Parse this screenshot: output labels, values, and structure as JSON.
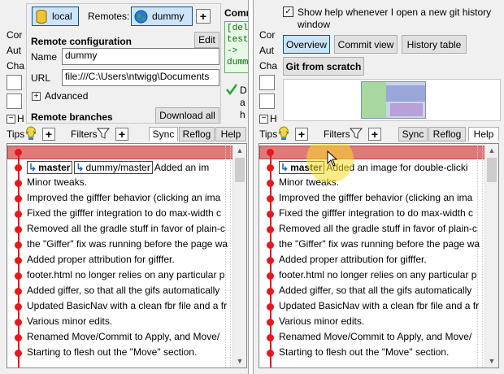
{
  "left": {
    "side_labels": [
      "Cor",
      "Aut",
      "Cha"
    ],
    "remote_location_button": "local",
    "remotes_label": "Remotes:",
    "remote_button": "dummy",
    "commit_header_partial": "Comr",
    "commit_preview_lines": [
      "[del",
      "test",
      "->",
      "dumm"
    ],
    "done_partial_lines": [
      "D",
      "a",
      "h"
    ],
    "remote_config_title": "Remote configuration",
    "edit_button": "Edit",
    "name_label": "Name",
    "name_value": "dummy",
    "url_label": "URL",
    "url_value": "file:///C:\\Users\\ntwigg\\Documents",
    "advanced_label": "Advanced",
    "remote_branches_title": "Remote branches",
    "download_all_button": "Download all",
    "collapse_header_partial": "H",
    "toolbar": {
      "tips": "Tips",
      "filters": "Filters",
      "sync": "Sync",
      "reflog": "Reflog",
      "help": "Help"
    },
    "branch_master": "master",
    "branch_remote": "dummy/master",
    "first_commit_text": "Added an im"
  },
  "right": {
    "side_labels": [
      "Cor",
      "Aut",
      "Cha"
    ],
    "show_help_checkbox": "Show help whenever I open a new git history window",
    "show_help_checked": true,
    "help_tabs": [
      "Overview",
      "Commit view",
      "History table"
    ],
    "git_from_scratch_button": "Git from scratch",
    "collapse_header_partial": "H",
    "toolbar": {
      "tips": "Tips",
      "filters": "Filters",
      "sync": "Sync",
      "reflog": "Reflog",
      "help": "Help"
    },
    "branch_master": "master",
    "first_commit_text": "Added an image for double-clicki"
  },
  "commits_left": [
    "Minor tweaks.",
    "Improved the gifffer behavior (clicking an ima",
    "Fixed the gifffer integration to do max-width c",
    "Removed all the gradle stuff in favor of plain-c",
    "the \"Giffer\" fix was running before the page wa",
    "Added proper attribution for gifffer.",
    "footer.html no longer relies on any particular p",
    "Added giffer, so that all the gifs automatically",
    "Updated BasicNav with a clean fbr file and a fr",
    "Various minor edits.",
    "Renamed Move/Commit to Apply, and Move/",
    "Starting to flesh out the \"Move\" section."
  ],
  "commits_right": [
    "Minor tweaks.",
    "Improved the gifffer behavior (clicking an ima",
    "Fixed the gifffer integration to do max-width c",
    "Removed all the gradle stuff in favor of plain-c",
    "the \"Giffer\" fix was running before the page wa",
    "Added proper attribution for gifffer.",
    "footer.html no longer relies on any particular p",
    "Added giffer, so that all the gifs automatically",
    "Updated BasicNav with a clean fbr file and a fr",
    "Various minor edits.",
    "Renamed Move/Commit to Apply, and Move/",
    "Starting to flesh out the \"Move\" section."
  ],
  "colors": {
    "graph_line": "#e41a1c",
    "working_copy_bar": "#e07a78",
    "selected_tab": "#cce4f7",
    "check_green": "#22a822"
  },
  "icons": {
    "local": "cylinder-database-icon",
    "remote": "globe-icon",
    "tips": "lightbulb-icon",
    "filters": "funnel-icon",
    "branch": "branch-arrow-icon",
    "cursor": "mouse-pointer-icon"
  }
}
